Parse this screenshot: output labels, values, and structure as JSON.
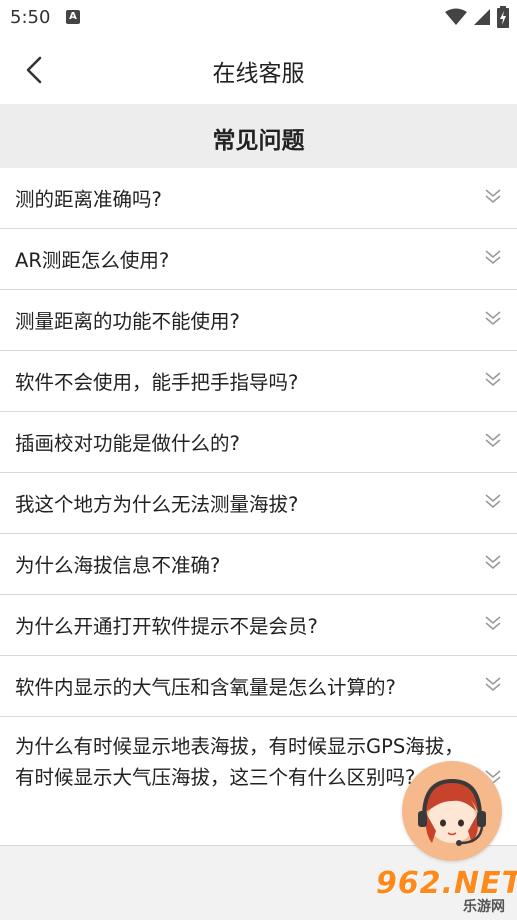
{
  "status_bar": {
    "time": "5:50",
    "notification_glyph": "A"
  },
  "header": {
    "title": "在线客服",
    "back_icon": "chevron-left-icon"
  },
  "section": {
    "title": "常见问题"
  },
  "faq": {
    "items": [
      {
        "question": "测的距离准确吗?"
      },
      {
        "question": "AR测距怎么使用?"
      },
      {
        "question": "测量距离的功能不能使用?"
      },
      {
        "question": "软件不会使用，能手把手指导吗?"
      },
      {
        "question": "插画校对功能是做什么的?"
      },
      {
        "question": "我这个地方为什么无法测量海拔?"
      },
      {
        "question": "为什么海拔信息不准确?"
      },
      {
        "question": "为什么开通打开软件提示不是会员?"
      },
      {
        "question": "软件内显示的大气压和含氧量是怎么计算的?"
      },
      {
        "question": "为什么有时候显示地表海拔，有时候显示GPS海拔，有时候显示大气压海拔，这三个有什么区别吗?"
      }
    ]
  },
  "watermark": {
    "main": "962.NET",
    "sub": "乐游网"
  },
  "colors": {
    "background": "#f2f2f2",
    "header_bg": "#ffffff",
    "section_bg": "#ededed",
    "chevron": "#9a9a9a",
    "avatar_bg": "#f5b98b",
    "watermark": "#ff8a1c"
  }
}
